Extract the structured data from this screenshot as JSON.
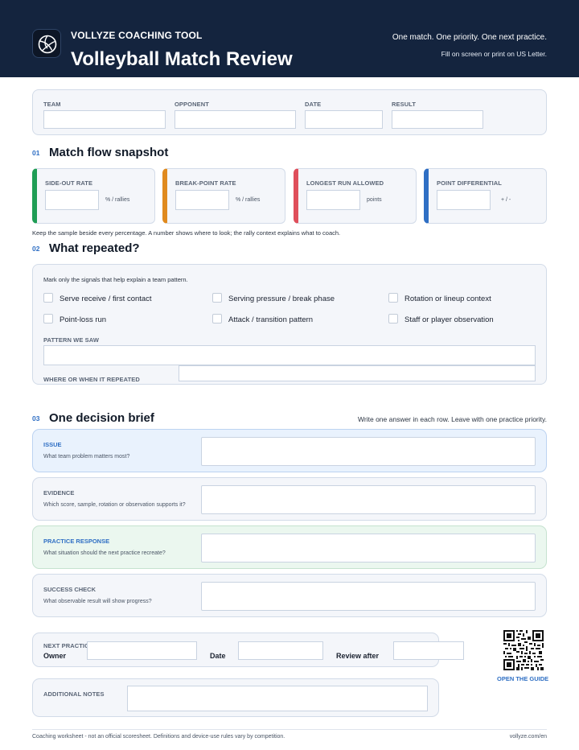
{
  "header": {
    "brand": "VOLLYZE COACHING TOOL",
    "title": "Volleyball Match Review",
    "tagline": "One match. One priority. One next practice.",
    "subtag": "Fill on screen or print on US Letter.",
    "logo_icon": "volleyball-icon"
  },
  "match_info": {
    "team_label": "TEAM",
    "opponent_label": "OPPONENT",
    "date_label": "DATE",
    "result_label": "RESULT"
  },
  "section1": {
    "num": "01",
    "title": "Match flow snapshot",
    "metrics": [
      {
        "label": "SIDE-OUT RATE",
        "unit": "% / rallies",
        "color": "#1f9d55"
      },
      {
        "label": "BREAK-POINT RATE",
        "unit": "% / rallies",
        "color": "#e08a1e"
      },
      {
        "label": "LONGEST RUN ALLOWED",
        "unit": "points",
        "color": "#df4f5b"
      },
      {
        "label": "POINT DIFFERENTIAL",
        "unit": "+ / -",
        "color": "#2f6fc4"
      }
    ],
    "note": "Keep the sample beside every percentage. A number shows where to look; the rally context explains what to coach."
  },
  "section2": {
    "num": "02",
    "title": "What repeated?",
    "instruction": "Mark only the signals that help explain a team pattern.",
    "checks": [
      "Serve receive / first contact",
      "Serving pressure / break phase",
      "Rotation or lineup context",
      "Point-loss run",
      "Attack / transition pattern",
      "Staff or player observation"
    ],
    "pattern_label": "PATTERN WE SAW",
    "where_label": "WHERE OR WHEN IT REPEATED"
  },
  "section3": {
    "num": "03",
    "title": "One decision brief",
    "instruction": "Write one answer in each row. Leave with one practice priority.",
    "rows": [
      {
        "title": "ISSUE",
        "question": "What team problem matters most?"
      },
      {
        "title": "EVIDENCE",
        "question": "Which score, sample, rotation or observation supports it?"
      },
      {
        "title": "PRACTICE RESPONSE",
        "question": "What situation should the next practice recreate?"
      },
      {
        "title": "SUCCESS CHECK",
        "question": "What observable result will show progress?"
      }
    ]
  },
  "next_practice": {
    "label": "NEXT PRACTIC",
    "owner_label": "Owner",
    "date_label": "Date",
    "review_label": "Review after"
  },
  "notes": {
    "label": "ADDITIONAL NOTES"
  },
  "guide": {
    "link": "OPEN THE GUIDE",
    "qr_icon": "qr-code-icon"
  },
  "footer": {
    "disclaimer": "Coaching worksheet - not an official scoresheet. Definitions and device-use rules vary by competition.",
    "url": "vollyze.com/en"
  }
}
